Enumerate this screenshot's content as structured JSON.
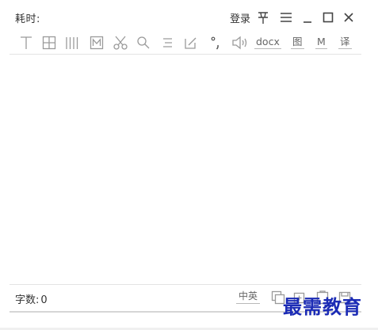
{
  "app": {
    "elapsed_label": "耗时:",
    "elapsed_value": "",
    "login_label": "登录"
  },
  "window_controls": {
    "pin": "pin-icon",
    "menu": "menu-icon",
    "minimize": "minimize-icon",
    "maximize": "maximize-icon",
    "close": "close-icon"
  },
  "toolbar": {
    "docx_label": "docx",
    "image_label": "图",
    "m_label": "M",
    "translate_label": "译"
  },
  "content": {
    "text": ""
  },
  "footer": {
    "char_count_label": "字数:",
    "char_count_value": "0",
    "lang_label": "中英"
  },
  "watermark": {
    "text": "最需教育"
  },
  "colors": {
    "icon": "#9a9a9a",
    "text": "#333333",
    "watermark": "#1b2bb5",
    "divider": "#e3e3e3"
  }
}
